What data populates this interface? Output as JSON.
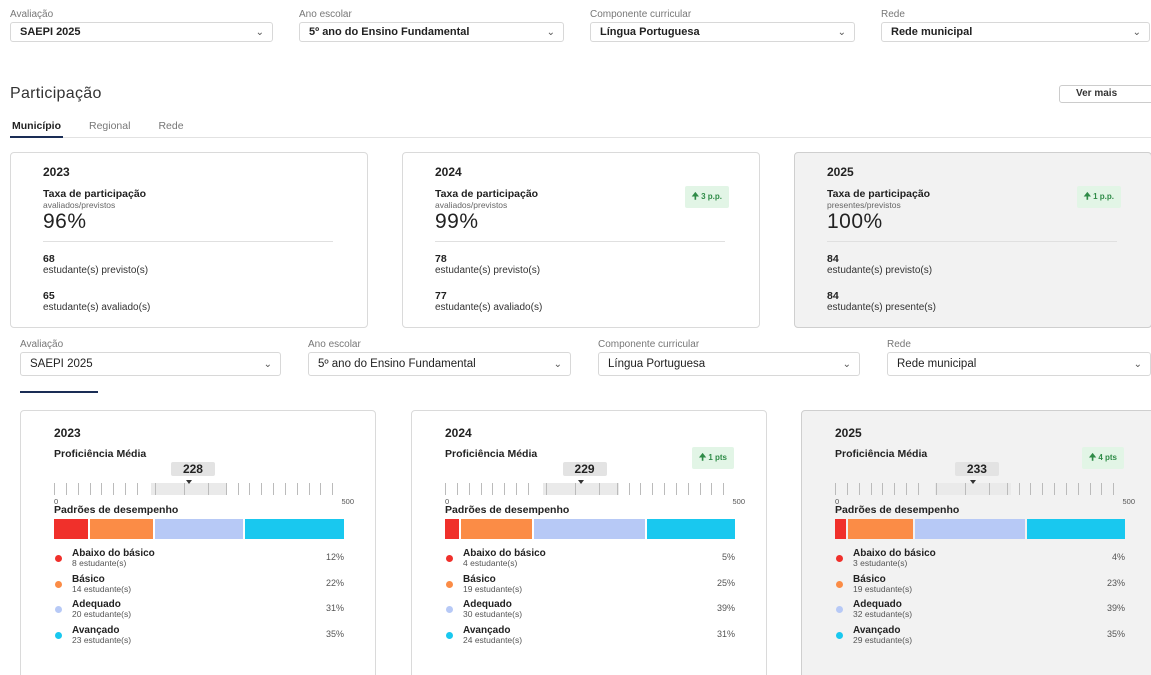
{
  "filters_top": [
    {
      "label": "Avaliação",
      "value": "SAEPI 2025",
      "width": 263
    },
    {
      "label": "Ano escolar",
      "value": "5º ano do Ensino Fundamental",
      "width": 265
    },
    {
      "label": "Componente curricular",
      "value": "Língua Portuguesa",
      "width": 265
    },
    {
      "label": "Rede",
      "value": "Rede municipal",
      "width": 269
    }
  ],
  "filters_bottom": [
    {
      "label": "Avaliação",
      "value": "SAEPI 2025",
      "width": 261
    },
    {
      "label": "Ano escolar",
      "value": "5º ano do Ensino Fundamental",
      "width": 263
    },
    {
      "label": "Componente curricular",
      "value": "Língua Portuguesa",
      "width": 262
    },
    {
      "label": "Rede",
      "value": "Rede municipal",
      "width": 264
    }
  ],
  "participacao": {
    "title": "Participação",
    "ver_mais": "Ver mais",
    "tabs": [
      "Município",
      "Regional",
      "Rede"
    ],
    "cards": [
      {
        "year": "2023",
        "taxa_label": "Taxa de participação",
        "taxa_sub": "avaliados/previstos",
        "pct": "96%",
        "badge": "",
        "n1": "68",
        "n1_label": "estudante(s) previsto(s)",
        "n2": "65",
        "n2_label": "estudante(s) avaliado(s)"
      },
      {
        "year": "2024",
        "taxa_label": "Taxa de participação",
        "taxa_sub": "avaliados/previstos",
        "pct": "99%",
        "badge": "3 p.p.",
        "n1": "78",
        "n1_label": "estudante(s) previsto(s)",
        "n2": "77",
        "n2_label": "estudante(s) avaliado(s)"
      },
      {
        "year": "2025",
        "taxa_label": "Taxa de participação",
        "taxa_sub": "presentes/previstos",
        "pct": "100%",
        "badge": "1 p.p.",
        "n1": "84",
        "n1_label": "estudante(s) previsto(s)",
        "n2": "84",
        "n2_label": "estudante(s) presente(s)"
      }
    ]
  },
  "proficiencia": {
    "colors": {
      "abaixo": "#f0302b",
      "basico": "#fb8c46",
      "adequado": "#b7c9f6",
      "avancado": "#19c8ef"
    },
    "cards": [
      {
        "year": "2023",
        "label": "Proficiência Média",
        "value": 228,
        "badge": "",
        "min": "0",
        "max": "500",
        "padroes_label": "Padrões de desempenho",
        "levels": [
          {
            "key": "abaixo",
            "name": "Abaixo do básico",
            "count": "8 estudante(s)",
            "pct": "12%",
            "frac": 12
          },
          {
            "key": "basico",
            "name": "Básico",
            "count": "14 estudante(s)",
            "pct": "22%",
            "frac": 22
          },
          {
            "key": "adequado",
            "name": "Adequado",
            "count": "20 estudante(s)",
            "pct": "31%",
            "frac": 31
          },
          {
            "key": "avancado",
            "name": "Avançado",
            "count": "23 estudante(s)",
            "pct": "35%",
            "frac": 35
          }
        ]
      },
      {
        "year": "2024",
        "label": "Proficiência Média",
        "value": 229,
        "badge": "1 pts",
        "min": "0",
        "max": "500",
        "padroes_label": "Padrões de desempenho",
        "levels": [
          {
            "key": "abaixo",
            "name": "Abaixo do básico",
            "count": "4 estudante(s)",
            "pct": "5%",
            "frac": 5
          },
          {
            "key": "basico",
            "name": "Básico",
            "count": "19 estudante(s)",
            "pct": "25%",
            "frac": 25
          },
          {
            "key": "adequado",
            "name": "Adequado",
            "count": "30 estudante(s)",
            "pct": "39%",
            "frac": 39
          },
          {
            "key": "avancado",
            "name": "Avançado",
            "count": "24 estudante(s)",
            "pct": "31%",
            "frac": 31
          }
        ]
      },
      {
        "year": "2025",
        "label": "Proficiência Média",
        "value": 233,
        "badge": "4 pts",
        "min": "0",
        "max": "500",
        "padroes_label": "Padrões de desempenho",
        "levels": [
          {
            "key": "abaixo",
            "name": "Abaixo do básico",
            "count": "3 estudante(s)",
            "pct": "4%",
            "frac": 4
          },
          {
            "key": "basico",
            "name": "Básico",
            "count": "19 estudante(s)",
            "pct": "23%",
            "frac": 23
          },
          {
            "key": "adequado",
            "name": "Adequado",
            "count": "32 estudante(s)",
            "pct": "39%",
            "frac": 39
          },
          {
            "key": "avancado",
            "name": "Avançado",
            "count": "29 estudante(s)",
            "pct": "35%",
            "frac": 35
          }
        ]
      }
    ]
  }
}
